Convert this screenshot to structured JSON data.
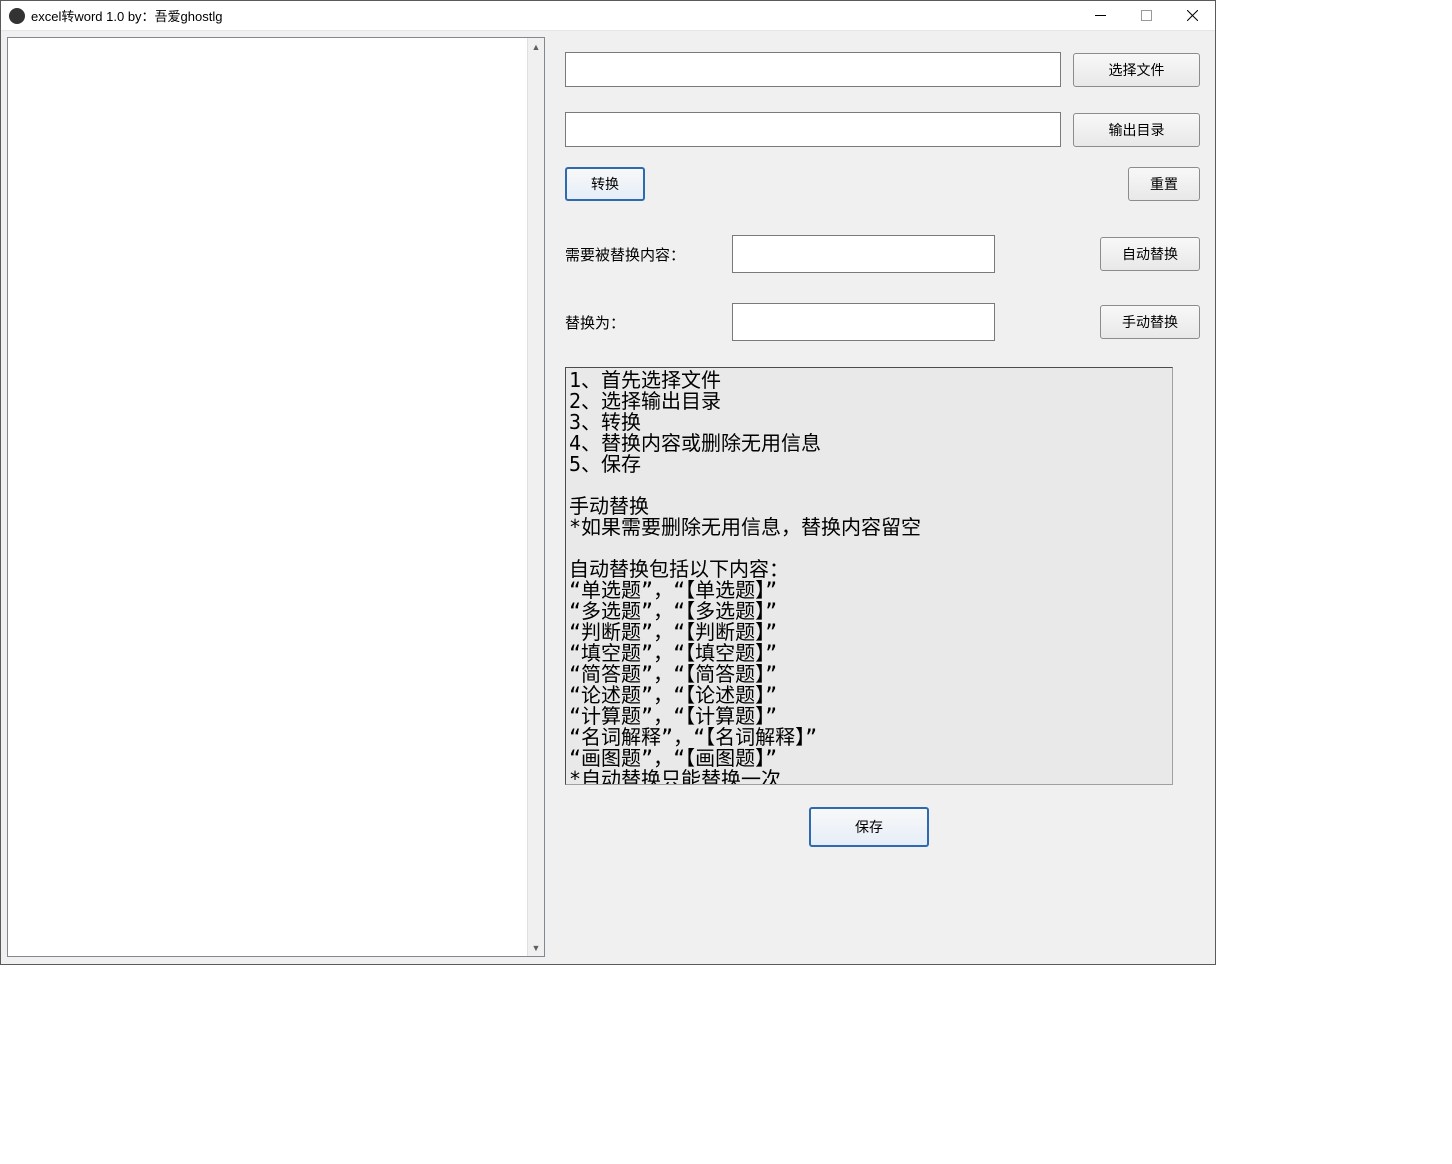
{
  "window": {
    "title": "excel转word 1.0 by：吾爱ghostlg"
  },
  "buttons": {
    "select_file": "选择文件",
    "output_dir": "输出目录",
    "convert": "转换",
    "reset": "重置",
    "auto_replace": "自动替换",
    "manual_replace": "手动替换",
    "save": "保存"
  },
  "labels": {
    "content_to_replace": "需要被替换内容：",
    "replace_with": "替换为："
  },
  "inputs": {
    "file_path": "",
    "output_path": "",
    "replace_from": "",
    "replace_to": ""
  },
  "instructions_text": "1、首先选择文件\n2、选择输出目录\n3、转换\n4、替换内容或删除无用信息\n5、保存\n\n手动替换\n*如果需要删除无用信息，替换内容留空\n\n自动替换包括以下内容：\n“单选题”，“【单选题】”\n“多选题”，“【多选题】”\n“判断题”，“【判断题】”\n“填空题”，“【填空题】”\n“简答题”，“【简答题】”\n“论述题”，“【论述题】”\n“计算题”，“【计算题】”\n“名词解释”，“【名词解释】”\n“画图题”，“【画图题】”\n*自动替换只能替换一次"
}
